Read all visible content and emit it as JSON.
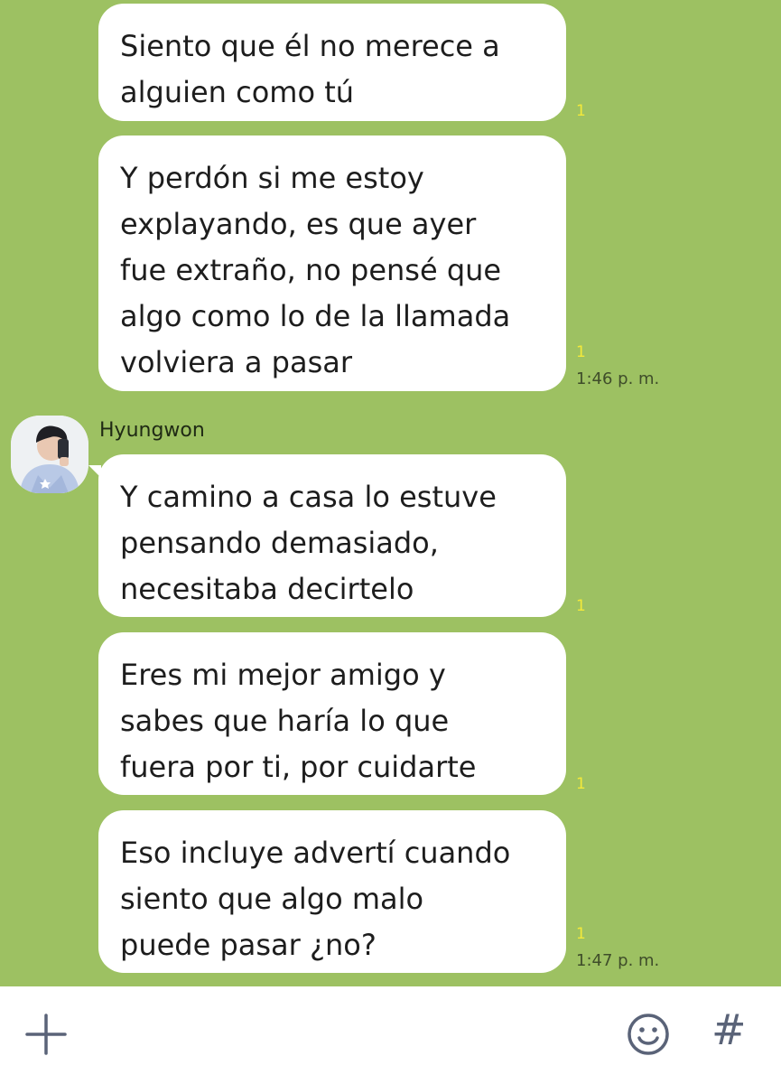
{
  "chat": {
    "contact_name": "Hyungwon",
    "messages": [
      {
        "text": "Siento que él no merece a\nalguien como tú",
        "read": "1",
        "time": ""
      },
      {
        "text": "Y perdón si me estoy\nexplayando, es que ayer\nfue extraño, no pensé que\nalgo como lo de la llamada\nvolviera a pasar",
        "read": "1",
        "time": "1:46 p. m."
      },
      {
        "text": "Y camino a casa lo estuve\npensando demasiado,\nnecesitaba decirtelo",
        "read": "1",
        "time": ""
      },
      {
        "text": "Eres mi mejor amigo y\nsabes que haría lo que\nfuera por ti, por cuidarte",
        "read": "1",
        "time": ""
      },
      {
        "text": "Eso incluye advertí cuando\nsiento que algo malo\npuede pasar ¿no?",
        "read": "1",
        "time": "1:47 p. m."
      }
    ]
  },
  "composer": {
    "plus_icon": "plus-icon",
    "emoji_icon": "smiley-icon",
    "hash_label": "#"
  },
  "colors": {
    "background": "#9dc162",
    "bubble": "#ffffff",
    "read_indicator": "#f3e93a"
  }
}
